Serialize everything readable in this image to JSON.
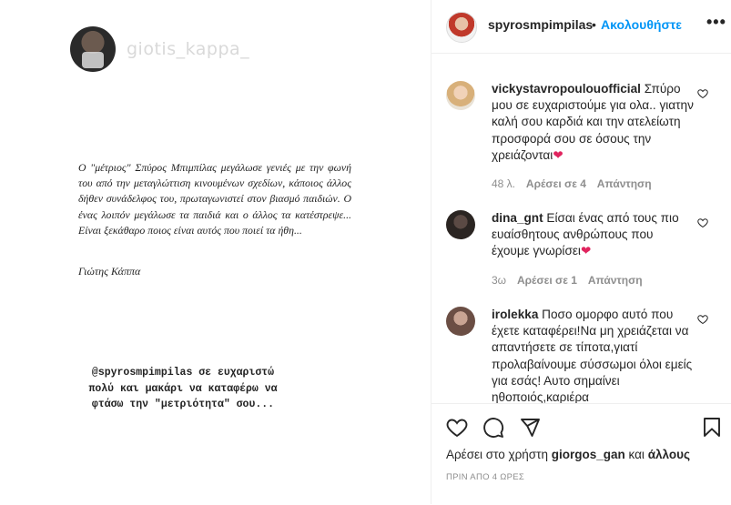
{
  "post": {
    "story_username": "giotis_kappa_",
    "quote_text": "Ο \"μέτριος\" Σπύρος Μπιμπίλας μεγάλωσε γενιές με την φωνή του από την μεταγλώττιση κινουμένων σχεδίων, κάποιος άλλος δήθεν συνάδελφος του, πρωταγωνιστεί στον βιασμό παιδιών. Ο ένας λοιπόν μεγάλωσε τα παιδιά και ο άλλος τα κατέστρεψε... Είναι ξεκάθαρο ποιος είναι αυτός που ποιεί τα ήθη...",
    "quote_signature": "Γιώτης Κάππα",
    "typewriter_text": "@spyrosmpimpilas σε ευχαριστώ πολύ και μακάρι να καταφέρω να φτάσω την \"μετριότητα\" σου..."
  },
  "header": {
    "username": "spyrosmpimpilas",
    "separator": "•",
    "follow_label": "Ακολουθήστε",
    "more_label": "•••"
  },
  "comments": [
    {
      "username": "vickystavropoulouofficial",
      "text": "Σπύρο μου σε ευχαριστούμε για ολα.. γιατην καλή σου καρδιά και την ατελείωτη προσφορά σου σε όσους την χρειάζονται",
      "emoji": "❤",
      "time": "48 λ.",
      "likes": "Αρέσει σε 4",
      "reply_label": "Απάντηση"
    },
    {
      "username": "dina_gnt",
      "text": "Είσαι ένας από τους πιο ευαίσθητους ανθρώπους που έχουμε γνωρίσει",
      "emoji": "❤",
      "time": "3ω",
      "likes": "Αρέσει σε 1",
      "reply_label": "Απάντηση"
    },
    {
      "username": "irolekka",
      "text": "Ποσο ομορφο αυτό που έχετε καταφέρει!Να μη χρειάζεται να απαντήσετε σε τίποτα,γιατί προλαβαίνουμε σύσσωμοι όλοι εμείς για εσάς! Αυτο σημαίνει ηθοποιός,καριέρα"
    }
  ],
  "footer": {
    "likes_prefix": "Αρέσει στο χρήστη",
    "likes_user": "giorgos_gan",
    "likes_suffix": "και",
    "likes_others": "άλλους",
    "timestamp": "ΠΡΙΝ ΑΠΟ 4 ΩΡΕΣ"
  },
  "colors": {
    "accent": "#0095f6",
    "heart": "#e0245e",
    "muted": "#8e8e8e"
  },
  "icons": [
    "heart-icon",
    "comment-icon",
    "share-icon",
    "bookmark-icon",
    "more-options-icon"
  ]
}
